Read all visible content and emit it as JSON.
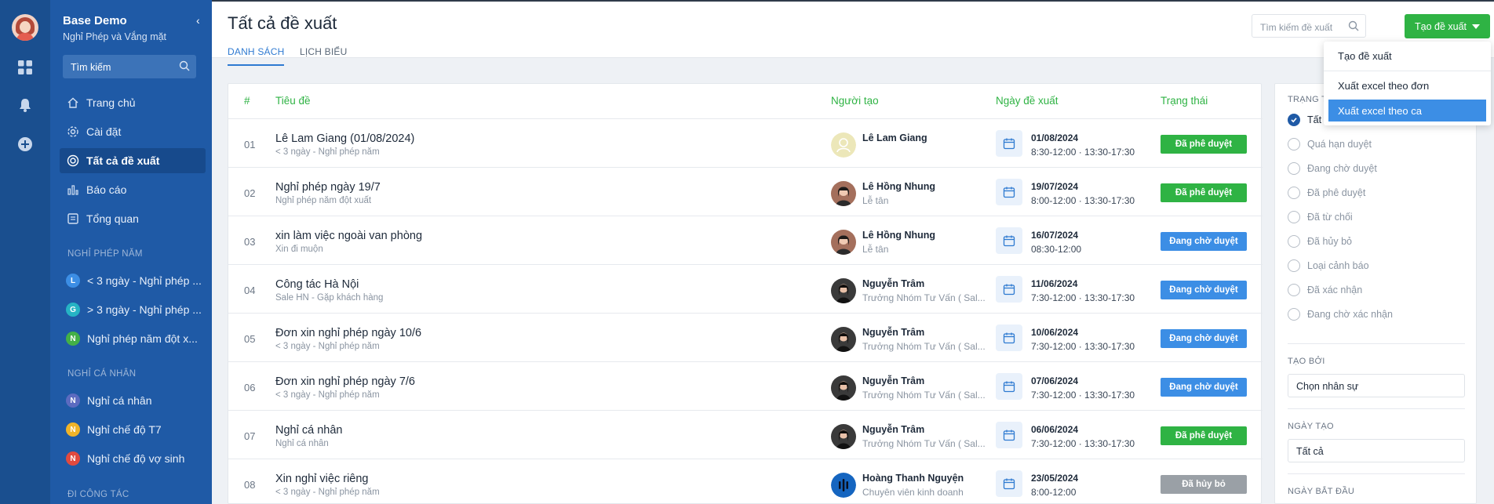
{
  "app": {
    "title": "Base Demo",
    "subtitle": "Nghỉ Phép và Vắng mặt",
    "search_placeholder": "Tìm kiếm"
  },
  "nav": [
    {
      "label": "Trang chủ",
      "icon": "home-icon"
    },
    {
      "label": "Cài đặt",
      "icon": "gear-icon"
    },
    {
      "label": "Tất cả đề xuất",
      "icon": "target-icon",
      "active": true
    },
    {
      "label": "Báo cáo",
      "icon": "bar-chart-icon"
    },
    {
      "label": "Tổng quan",
      "icon": "overview-icon"
    }
  ],
  "sections": [
    {
      "title": "NGHỈ PHÉP NĂM",
      "items": [
        {
          "letter": "L",
          "color": "#3c8ee5",
          "label": "< 3 ngày - Nghỉ phép ..."
        },
        {
          "letter": "G",
          "color": "#26b3c4",
          "label": "> 3 ngày - Nghỉ phép ..."
        },
        {
          "letter": "N",
          "color": "#43b047",
          "label": "Nghỉ phép năm đột x..."
        }
      ]
    },
    {
      "title": "NGHỈ CÁ NHÂN",
      "items": [
        {
          "letter": "N",
          "color": "#5c6bc0",
          "label": "Nghỉ cá nhân"
        },
        {
          "letter": "N",
          "color": "#f0b429",
          "label": "Nghỉ chế độ T7"
        },
        {
          "letter": "N",
          "color": "#e04a3f",
          "label": "Nghỉ chế độ vợ sinh"
        }
      ]
    },
    {
      "title": "ĐI CÔNG TÁC",
      "items": []
    }
  ],
  "header": {
    "title": "Tất cả đề xuất",
    "tabs": [
      "DANH SÁCH",
      "LỊCH BIỂU"
    ],
    "search_placeholder": "Tìm kiếm đề xuất",
    "create_label": "Tạo đề xuất"
  },
  "dropdown": [
    "Tạo đề xuất",
    "Xuất excel theo đơn",
    "Xuất excel theo ca"
  ],
  "table": {
    "headers": [
      "#",
      "Tiêu đề",
      "Người tạo",
      "Ngày đề xuất",
      "Trạng thái"
    ],
    "rows": [
      {
        "num": "01",
        "title": "Lê Lam Giang (01/08/2024)",
        "sub": "< 3 ngày - Nghỉ phép năm",
        "user": "Lê Lam Giang",
        "role": "",
        "avatar": "placeholder",
        "date": "01/08/2024",
        "time": "8:30-12:00 · 13:30-17:30",
        "status": "Đã phê duyệt",
        "status_color": "#2fb344"
      },
      {
        "num": "02",
        "title": "Nghỉ phép ngày 19/7",
        "sub": "Nghỉ phép năm đột xuất",
        "user": "Lê Hồng Nhung",
        "role": "Lễ tân",
        "avatar": "photo-a",
        "date": "19/07/2024",
        "time": "8:00-12:00 · 13:30-17:30",
        "status": "Đã phê duyệt",
        "status_color": "#2fb344"
      },
      {
        "num": "03",
        "title": "xin làm việc ngoài van phòng",
        "sub": "Xin đi muộn",
        "user": "Lê Hồng Nhung",
        "role": "Lễ tân",
        "avatar": "photo-a",
        "date": "16/07/2024",
        "time": "08:30-12:00",
        "status": "Đang chờ duyệt",
        "status_color": "#3c8ee5"
      },
      {
        "num": "04",
        "title": "Công tác Hà Nội",
        "sub": "Sale HN - Gặp khách hàng",
        "user": "Nguyễn Trâm",
        "role": "Trưởng Nhóm Tư Vấn ( Sal...",
        "avatar": "photo-b",
        "date": "11/06/2024",
        "time": "7:30-12:00 · 13:30-17:30",
        "status": "Đang chờ duyệt",
        "status_color": "#3c8ee5"
      },
      {
        "num": "05",
        "title": "Đơn xin nghỉ phép ngày 10/6",
        "sub": "< 3 ngày - Nghỉ phép năm",
        "user": "Nguyễn Trâm",
        "role": "Trưởng Nhóm Tư Vấn ( Sal...",
        "avatar": "photo-b",
        "date": "10/06/2024",
        "time": "7:30-12:00 · 13:30-17:30",
        "status": "Đang chờ duyệt",
        "status_color": "#3c8ee5"
      },
      {
        "num": "06",
        "title": "Đơn xin nghỉ phép ngày 7/6",
        "sub": "< 3 ngày - Nghỉ phép năm",
        "user": "Nguyễn Trâm",
        "role": "Trưởng Nhóm Tư Vấn ( Sal...",
        "avatar": "photo-b",
        "date": "07/06/2024",
        "time": "7:30-12:00 · 13:30-17:30",
        "status": "Đang chờ duyệt",
        "status_color": "#3c8ee5"
      },
      {
        "num": "07",
        "title": "Nghỉ cá nhân",
        "sub": "Nghỉ cá nhân",
        "user": "Nguyễn Trâm",
        "role": "Trưởng Nhóm Tư Vấn ( Sal...",
        "avatar": "photo-b",
        "date": "06/06/2024",
        "time": "7:30-12:00 · 13:30-17:30",
        "status": "Đã phê duyệt",
        "status_color": "#2fb344"
      },
      {
        "num": "08",
        "title": "Xin nghỉ việc riêng",
        "sub": "< 3 ngày - Nghỉ phép năm",
        "user": "Hoàng Thanh Nguyện",
        "role": "Chuyên viên kinh doanh",
        "avatar": "photo-c",
        "date": "23/05/2024",
        "time": "8:00-12:00",
        "status": "Đã hủy bỏ",
        "status_color": "#9aa0a6"
      }
    ]
  },
  "filters": {
    "status_head": "TRẠNG THÁI",
    "statuses": [
      "Tất cả",
      "Quá hạn duyệt",
      "Đang chờ duyệt",
      "Đã phê duyệt",
      "Đã từ chối",
      "Đã hủy bỏ",
      "Loại cảnh báo",
      "Đã xác nhận",
      "Đang chờ xác nhận"
    ],
    "created_by_head": "TẠO BỞI",
    "created_by_value": "Chọn nhân sự",
    "created_date_head": "NGÀY TẠO",
    "created_date_value": "Tất cả",
    "start_date_head": "NGÀY BẮT ĐẦU"
  }
}
